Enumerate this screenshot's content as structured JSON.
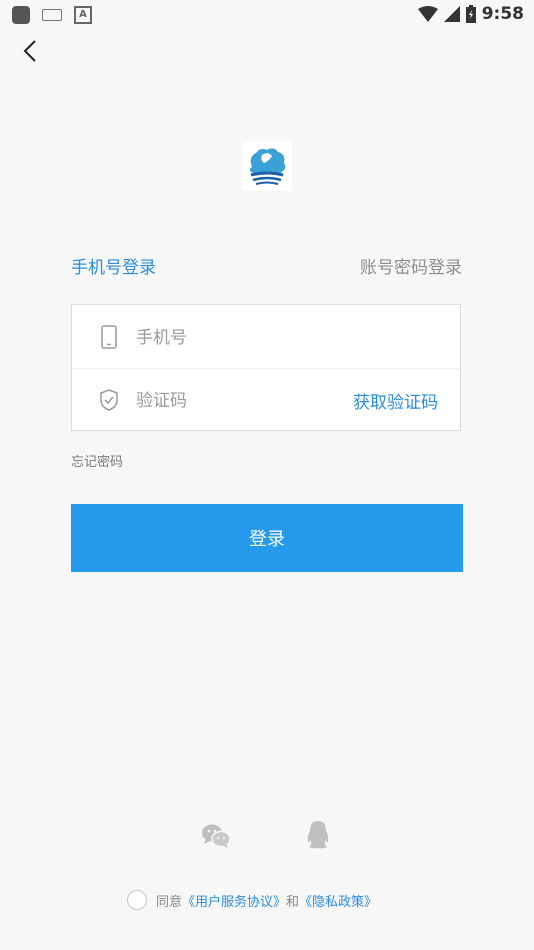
{
  "status_bar": {
    "time": "9:58",
    "input_indicator": "A"
  },
  "tabs": {
    "phone_login": "手机号登录",
    "account_login": "账号密码登录"
  },
  "form": {
    "phone_placeholder": "手机号",
    "code_placeholder": "验证码",
    "get_code": "获取验证码"
  },
  "forgot_password": "忘记密码",
  "login_button": "登录",
  "agreement": {
    "prefix": "同意",
    "user_agreement": "《用户服务协议》",
    "and": "和",
    "privacy_policy": "《隐私政策》"
  },
  "colors": {
    "accent": "#2599ec",
    "link": "#2b8de0",
    "background": "#f7f7f7"
  }
}
